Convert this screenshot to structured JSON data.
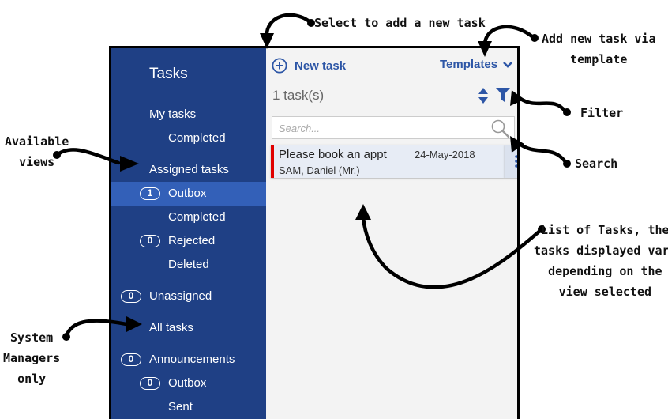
{
  "sidebar": {
    "title": "Tasks",
    "items": [
      {
        "label": "My tasks"
      },
      {
        "label": "Completed"
      },
      {
        "label": "Assigned tasks"
      },
      {
        "label": "Outbox",
        "badge": "1"
      },
      {
        "label": "Completed"
      },
      {
        "label": "Rejected",
        "badge": "0"
      },
      {
        "label": "Deleted"
      },
      {
        "label": "Unassigned",
        "badge": "0"
      },
      {
        "label": "All tasks"
      },
      {
        "label": "Announcements",
        "badge": "0"
      },
      {
        "label": "Outbox",
        "badge": "0"
      },
      {
        "label": "Sent"
      }
    ]
  },
  "toolbar": {
    "new_task_label": "New task",
    "templates_label": "Templates"
  },
  "list": {
    "count_label": "1 task(s)",
    "search_placeholder": "Search...",
    "tasks": [
      {
        "title": "Please book an appt",
        "date": "24-May-2018",
        "patient": "SAM, Daniel (Mr.)"
      }
    ]
  },
  "annotations": {
    "new_task": "Select to add a new task",
    "template": [
      "Add new task via",
      "template"
    ],
    "filter": "Filter",
    "search": "Search",
    "views": [
      "Available",
      "views"
    ],
    "list": [
      "List of Tasks, the",
      "tasks displayed vary",
      "depending on the",
      "view selected"
    ],
    "system": [
      "System",
      "Managers",
      "only"
    ]
  },
  "colors": {
    "sidebar_bg": "#1f4085",
    "sidebar_active": "#3360b8",
    "accent": "#2d56a6",
    "priority_red": "#e00000"
  }
}
